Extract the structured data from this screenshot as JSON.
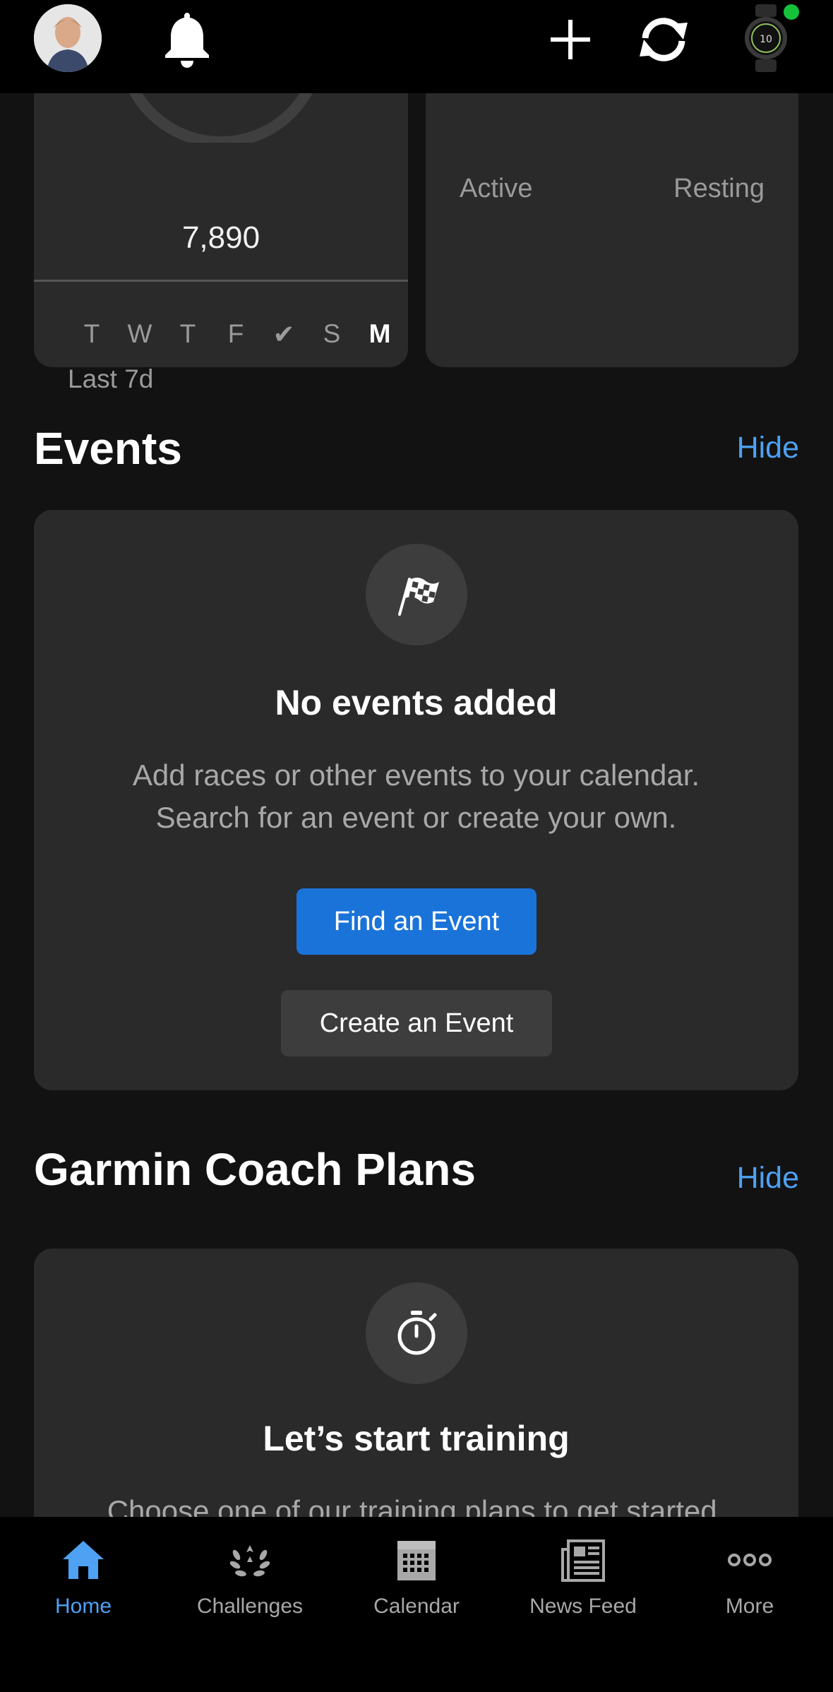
{
  "colors": {
    "background": "#121212",
    "card": "#2a2a2a",
    "accent": "#4ea1f3",
    "primary_button": "#1a73d9",
    "watch_status": "#16c13a"
  },
  "header": {
    "icons": [
      "avatar",
      "bell-icon",
      "plus-icon",
      "sync-icon",
      "watch-icon"
    ]
  },
  "steps_card": {
    "value": "7,890",
    "weekdays": [
      "T",
      "W",
      "T",
      "F",
      "✔",
      "S",
      "M"
    ],
    "range_label": "Last 7d"
  },
  "calories_card": {
    "active_label": "Active",
    "resting_label": "Resting"
  },
  "events": {
    "title": "Events",
    "hide_label": "Hide",
    "icon": "checkered-flag-icon",
    "heading": "No events added",
    "description_line1": "Add races or other events to your calendar.",
    "description_line2": "Search for an event or create your own.",
    "find_button": "Find an Event",
    "create_button": "Create an Event"
  },
  "coach": {
    "title": "Garmin Coach Plans",
    "hide_label": "Hide",
    "icon": "stopwatch-icon",
    "heading": "Let’s start training",
    "description": "Choose one of our training plans to get started."
  },
  "nav": {
    "items": [
      {
        "label": "Home",
        "icon": "home-icon",
        "active": true
      },
      {
        "label": "Challenges",
        "icon": "laurel-icon",
        "active": false
      },
      {
        "label": "Calendar",
        "icon": "calendar-icon",
        "active": false
      },
      {
        "label": "News Feed",
        "icon": "newspaper-icon",
        "active": false
      },
      {
        "label": "More",
        "icon": "more-icon",
        "active": false
      }
    ]
  }
}
